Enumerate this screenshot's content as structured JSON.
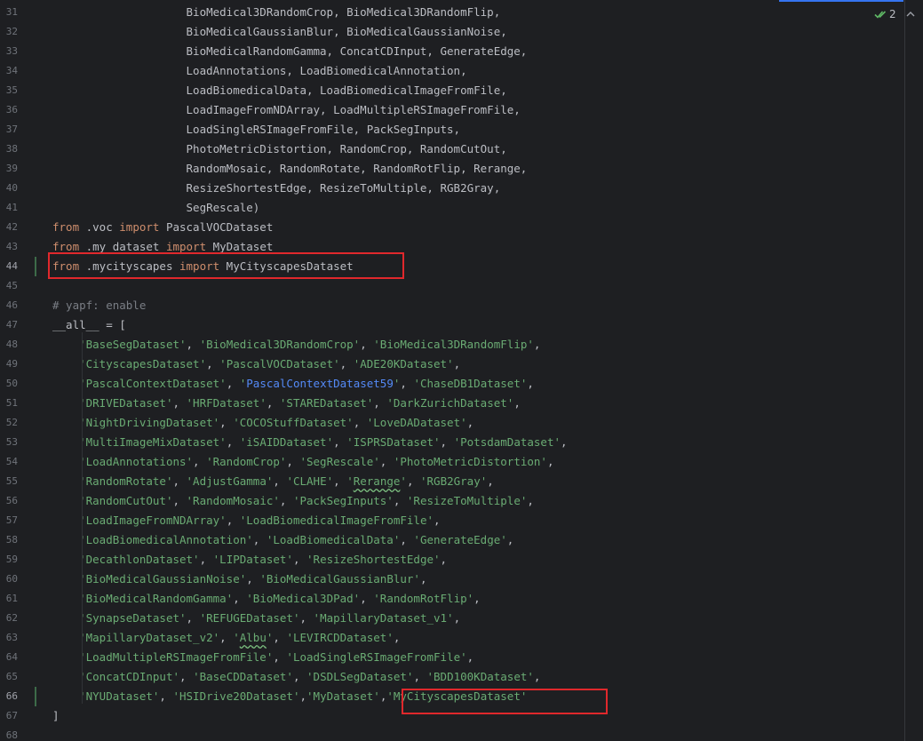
{
  "editor": {
    "inspection_count": "2",
    "line_numbers": [
      "31",
      "32",
      "33",
      "34",
      "35",
      "36",
      "37",
      "38",
      "39",
      "40",
      "41",
      "42",
      "43",
      "44",
      "45",
      "46",
      "47",
      "48",
      "49",
      "50",
      "51",
      "52",
      "53",
      "54",
      "55",
      "56",
      "57",
      "58",
      "59",
      "60",
      "61",
      "62",
      "63",
      "64",
      "65",
      "66",
      "67",
      "68"
    ],
    "lines": [
      {
        "n": "31",
        "tokens": [
          {
            "t": "                    BioMedical3DRandomCrop, BioMedical3DRandomFlip,",
            "c": ""
          }
        ]
      },
      {
        "n": "32",
        "tokens": [
          {
            "t": "                    BioMedicalGaussianBlur, BioMedicalGaussianNoise,",
            "c": ""
          }
        ]
      },
      {
        "n": "33",
        "tokens": [
          {
            "t": "                    BioMedicalRandomGamma, ConcatCDInput, GenerateEdge,",
            "c": ""
          }
        ]
      },
      {
        "n": "34",
        "tokens": [
          {
            "t": "                    LoadAnnotations, LoadBiomedicalAnnotation,",
            "c": ""
          }
        ]
      },
      {
        "n": "35",
        "tokens": [
          {
            "t": "                    LoadBiomedicalData, LoadBiomedicalImageFromFile,",
            "c": ""
          }
        ]
      },
      {
        "n": "36",
        "tokens": [
          {
            "t": "                    LoadImageFromNDArray, LoadMultipleRSImageFromFile,",
            "c": ""
          }
        ]
      },
      {
        "n": "37",
        "tokens": [
          {
            "t": "                    LoadSingleRSImageFromFile, PackSegInputs,",
            "c": ""
          }
        ]
      },
      {
        "n": "38",
        "tokens": [
          {
            "t": "                    PhotoMetricDistortion, RandomCrop, RandomCutOut,",
            "c": ""
          }
        ]
      },
      {
        "n": "39",
        "tokens": [
          {
            "t": "                    RandomMosaic, RandomRotate, RandomRotFlip, Rerange,",
            "c": ""
          }
        ]
      },
      {
        "n": "40",
        "tokens": [
          {
            "t": "                    ResizeShortestEdge, ResizeToMultiple, RGB2Gray,",
            "c": ""
          }
        ]
      },
      {
        "n": "41",
        "tokens": [
          {
            "t": "                    SegRescale)",
            "c": ""
          }
        ]
      },
      {
        "n": "42",
        "tokens": [
          {
            "t": "from",
            "c": "kw"
          },
          {
            "t": " .voc ",
            "c": ""
          },
          {
            "t": "import",
            "c": "kw"
          },
          {
            "t": " PascalVOCDataset",
            "c": ""
          }
        ]
      },
      {
        "n": "43",
        "tokens": [
          {
            "t": "from",
            "c": "kw"
          },
          {
            "t": " .my_dataset ",
            "c": ""
          },
          {
            "t": "import",
            "c": "kw"
          },
          {
            "t": " MyDataset",
            "c": ""
          }
        ]
      },
      {
        "n": "44",
        "tokens": [
          {
            "t": "from",
            "c": "kw"
          },
          {
            "t": " .mycityscapes ",
            "c": ""
          },
          {
            "t": "import",
            "c": "kw"
          },
          {
            "t": " MyCityscapesDataset",
            "c": ""
          }
        ]
      },
      {
        "n": "45",
        "tokens": []
      },
      {
        "n": "46",
        "tokens": [
          {
            "t": "# yapf: enable",
            "c": "cm"
          }
        ]
      },
      {
        "n": "47",
        "tokens": [
          {
            "t": "__all__ = [",
            "c": ""
          }
        ]
      },
      {
        "n": "48",
        "tokens": [
          {
            "t": "    ",
            "c": ""
          },
          {
            "t": "'BaseSegDataset'",
            "c": "str"
          },
          {
            "t": ", ",
            "c": ""
          },
          {
            "t": "'BioMedical3DRandomCrop'",
            "c": "str"
          },
          {
            "t": ", ",
            "c": ""
          },
          {
            "t": "'BioMedical3DRandomFlip'",
            "c": "str"
          },
          {
            "t": ",",
            "c": ""
          }
        ]
      },
      {
        "n": "49",
        "tokens": [
          {
            "t": "    ",
            "c": ""
          },
          {
            "t": "'CityscapesDataset'",
            "c": "str"
          },
          {
            "t": ", ",
            "c": ""
          },
          {
            "t": "'PascalVOCDataset'",
            "c": "str"
          },
          {
            "t": ", ",
            "c": ""
          },
          {
            "t": "'ADE20KDataset'",
            "c": "str"
          },
          {
            "t": ",",
            "c": ""
          }
        ]
      },
      {
        "n": "50",
        "tokens": [
          {
            "t": "    ",
            "c": ""
          },
          {
            "t": "'PascalContextDataset'",
            "c": "str"
          },
          {
            "t": ", ",
            "c": ""
          },
          {
            "t": "'",
            "c": "str"
          },
          {
            "t": "PascalContextDataset59",
            "c": "lnk"
          },
          {
            "t": "'",
            "c": "str"
          },
          {
            "t": ", ",
            "c": ""
          },
          {
            "t": "'ChaseDB1Dataset'",
            "c": "str"
          },
          {
            "t": ",",
            "c": ""
          }
        ]
      },
      {
        "n": "51",
        "tokens": [
          {
            "t": "    ",
            "c": ""
          },
          {
            "t": "'DRIVEDataset'",
            "c": "str"
          },
          {
            "t": ", ",
            "c": ""
          },
          {
            "t": "'HRFDataset'",
            "c": "str"
          },
          {
            "t": ", ",
            "c": ""
          },
          {
            "t": "'STAREDataset'",
            "c": "str"
          },
          {
            "t": ", ",
            "c": ""
          },
          {
            "t": "'DarkZurichDataset'",
            "c": "str"
          },
          {
            "t": ",",
            "c": ""
          }
        ]
      },
      {
        "n": "52",
        "tokens": [
          {
            "t": "    ",
            "c": ""
          },
          {
            "t": "'NightDrivingDataset'",
            "c": "str"
          },
          {
            "t": ", ",
            "c": ""
          },
          {
            "t": "'COCOStuffDataset'",
            "c": "str"
          },
          {
            "t": ", ",
            "c": ""
          },
          {
            "t": "'LoveDADataset'",
            "c": "str"
          },
          {
            "t": ",",
            "c": ""
          }
        ]
      },
      {
        "n": "53",
        "tokens": [
          {
            "t": "    ",
            "c": ""
          },
          {
            "t": "'MultiImageMixDataset'",
            "c": "str"
          },
          {
            "t": ", ",
            "c": ""
          },
          {
            "t": "'iSAIDDataset'",
            "c": "str"
          },
          {
            "t": ", ",
            "c": ""
          },
          {
            "t": "'ISPRSDataset'",
            "c": "str"
          },
          {
            "t": ", ",
            "c": ""
          },
          {
            "t": "'PotsdamDataset'",
            "c": "str"
          },
          {
            "t": ",",
            "c": ""
          }
        ]
      },
      {
        "n": "54",
        "tokens": [
          {
            "t": "    ",
            "c": ""
          },
          {
            "t": "'LoadAnnotations'",
            "c": "str"
          },
          {
            "t": ", ",
            "c": ""
          },
          {
            "t": "'RandomCrop'",
            "c": "str"
          },
          {
            "t": ", ",
            "c": ""
          },
          {
            "t": "'SegRescale'",
            "c": "str"
          },
          {
            "t": ", ",
            "c": ""
          },
          {
            "t": "'PhotoMetricDistortion'",
            "c": "str"
          },
          {
            "t": ",",
            "c": ""
          }
        ]
      },
      {
        "n": "55",
        "tokens": [
          {
            "t": "    ",
            "c": ""
          },
          {
            "t": "'RandomRotate'",
            "c": "str"
          },
          {
            "t": ", ",
            "c": ""
          },
          {
            "t": "'AdjustGamma'",
            "c": "str"
          },
          {
            "t": ", ",
            "c": ""
          },
          {
            "t": "'CLAHE'",
            "c": "str"
          },
          {
            "t": ", ",
            "c": ""
          },
          {
            "t": "'",
            "c": "str"
          },
          {
            "t": "Rerange",
            "c": "str wavy"
          },
          {
            "t": "'",
            "c": "str"
          },
          {
            "t": ", ",
            "c": ""
          },
          {
            "t": "'RGB2Gray'",
            "c": "str"
          },
          {
            "t": ",",
            "c": ""
          }
        ]
      },
      {
        "n": "56",
        "tokens": [
          {
            "t": "    ",
            "c": ""
          },
          {
            "t": "'RandomCutOut'",
            "c": "str"
          },
          {
            "t": ", ",
            "c": ""
          },
          {
            "t": "'RandomMosaic'",
            "c": "str"
          },
          {
            "t": ", ",
            "c": ""
          },
          {
            "t": "'PackSegInputs'",
            "c": "str"
          },
          {
            "t": ", ",
            "c": ""
          },
          {
            "t": "'ResizeToMultiple'",
            "c": "str"
          },
          {
            "t": ",",
            "c": ""
          }
        ]
      },
      {
        "n": "57",
        "tokens": [
          {
            "t": "    ",
            "c": ""
          },
          {
            "t": "'LoadImageFromNDArray'",
            "c": "str"
          },
          {
            "t": ", ",
            "c": ""
          },
          {
            "t": "'LoadBiomedicalImageFromFile'",
            "c": "str"
          },
          {
            "t": ",",
            "c": ""
          }
        ]
      },
      {
        "n": "58",
        "tokens": [
          {
            "t": "    ",
            "c": ""
          },
          {
            "t": "'LoadBiomedicalAnnotation'",
            "c": "str"
          },
          {
            "t": ", ",
            "c": ""
          },
          {
            "t": "'LoadBiomedicalData'",
            "c": "str"
          },
          {
            "t": ", ",
            "c": ""
          },
          {
            "t": "'GenerateEdge'",
            "c": "str"
          },
          {
            "t": ",",
            "c": ""
          }
        ]
      },
      {
        "n": "59",
        "tokens": [
          {
            "t": "    ",
            "c": ""
          },
          {
            "t": "'DecathlonDataset'",
            "c": "str"
          },
          {
            "t": ", ",
            "c": ""
          },
          {
            "t": "'LIPDataset'",
            "c": "str"
          },
          {
            "t": ", ",
            "c": ""
          },
          {
            "t": "'ResizeShortestEdge'",
            "c": "str"
          },
          {
            "t": ",",
            "c": ""
          }
        ]
      },
      {
        "n": "60",
        "tokens": [
          {
            "t": "    ",
            "c": ""
          },
          {
            "t": "'BioMedicalGaussianNoise'",
            "c": "str"
          },
          {
            "t": ", ",
            "c": ""
          },
          {
            "t": "'BioMedicalGaussianBlur'",
            "c": "str"
          },
          {
            "t": ",",
            "c": ""
          }
        ]
      },
      {
        "n": "61",
        "tokens": [
          {
            "t": "    ",
            "c": ""
          },
          {
            "t": "'BioMedicalRandomGamma'",
            "c": "str"
          },
          {
            "t": ", ",
            "c": ""
          },
          {
            "t": "'BioMedical3DPad'",
            "c": "str"
          },
          {
            "t": ", ",
            "c": ""
          },
          {
            "t": "'RandomRotFlip'",
            "c": "str"
          },
          {
            "t": ",",
            "c": ""
          }
        ]
      },
      {
        "n": "62",
        "tokens": [
          {
            "t": "    ",
            "c": ""
          },
          {
            "t": "'SynapseDataset'",
            "c": "str"
          },
          {
            "t": ", ",
            "c": ""
          },
          {
            "t": "'REFUGEDataset'",
            "c": "str"
          },
          {
            "t": ", ",
            "c": ""
          },
          {
            "t": "'MapillaryDataset_v1'",
            "c": "str"
          },
          {
            "t": ",",
            "c": ""
          }
        ]
      },
      {
        "n": "63",
        "tokens": [
          {
            "t": "    ",
            "c": ""
          },
          {
            "t": "'MapillaryDataset_v2'",
            "c": "str"
          },
          {
            "t": ", ",
            "c": ""
          },
          {
            "t": "'",
            "c": "str"
          },
          {
            "t": "Albu",
            "c": "str wavy"
          },
          {
            "t": "'",
            "c": "str"
          },
          {
            "t": ", ",
            "c": ""
          },
          {
            "t": "'LEVIRCDDataset'",
            "c": "str"
          },
          {
            "t": ",",
            "c": ""
          }
        ]
      },
      {
        "n": "64",
        "tokens": [
          {
            "t": "    ",
            "c": ""
          },
          {
            "t": "'LoadMultipleRSImageFromFile'",
            "c": "str"
          },
          {
            "t": ", ",
            "c": ""
          },
          {
            "t": "'LoadSingleRSImageFromFile'",
            "c": "str"
          },
          {
            "t": ",",
            "c": ""
          }
        ]
      },
      {
        "n": "65",
        "tokens": [
          {
            "t": "    ",
            "c": ""
          },
          {
            "t": "'ConcatCDInput'",
            "c": "str"
          },
          {
            "t": ", ",
            "c": ""
          },
          {
            "t": "'BaseCDDataset'",
            "c": "str"
          },
          {
            "t": ", ",
            "c": ""
          },
          {
            "t": "'DSDLSegDataset'",
            "c": "str"
          },
          {
            "t": ", ",
            "c": ""
          },
          {
            "t": "'BDD100KDataset'",
            "c": "str"
          },
          {
            "t": ",",
            "c": ""
          }
        ]
      },
      {
        "n": "66",
        "tokens": [
          {
            "t": "    ",
            "c": ""
          },
          {
            "t": "'NYUDataset'",
            "c": "str"
          },
          {
            "t": ", ",
            "c": ""
          },
          {
            "t": "'HSIDrive20Dataset'",
            "c": "str"
          },
          {
            "t": ",",
            "c": ""
          },
          {
            "t": "'MyDataset'",
            "c": "str"
          },
          {
            "t": ",",
            "c": ""
          },
          {
            "t": "'MyCityscapesDataset'",
            "c": "str"
          }
        ]
      },
      {
        "n": "67",
        "tokens": [
          {
            "t": "]",
            "c": ""
          }
        ]
      },
      {
        "n": "68",
        "tokens": []
      }
    ]
  },
  "colors": {
    "background": "#1e1f22",
    "keyword": "#cf8e6d",
    "string": "#6aab73",
    "comment": "#7a7e85",
    "text": "#bcbec4",
    "link": "#548af7",
    "highlight_box": "#e0282c",
    "accent": "#3574f0"
  }
}
